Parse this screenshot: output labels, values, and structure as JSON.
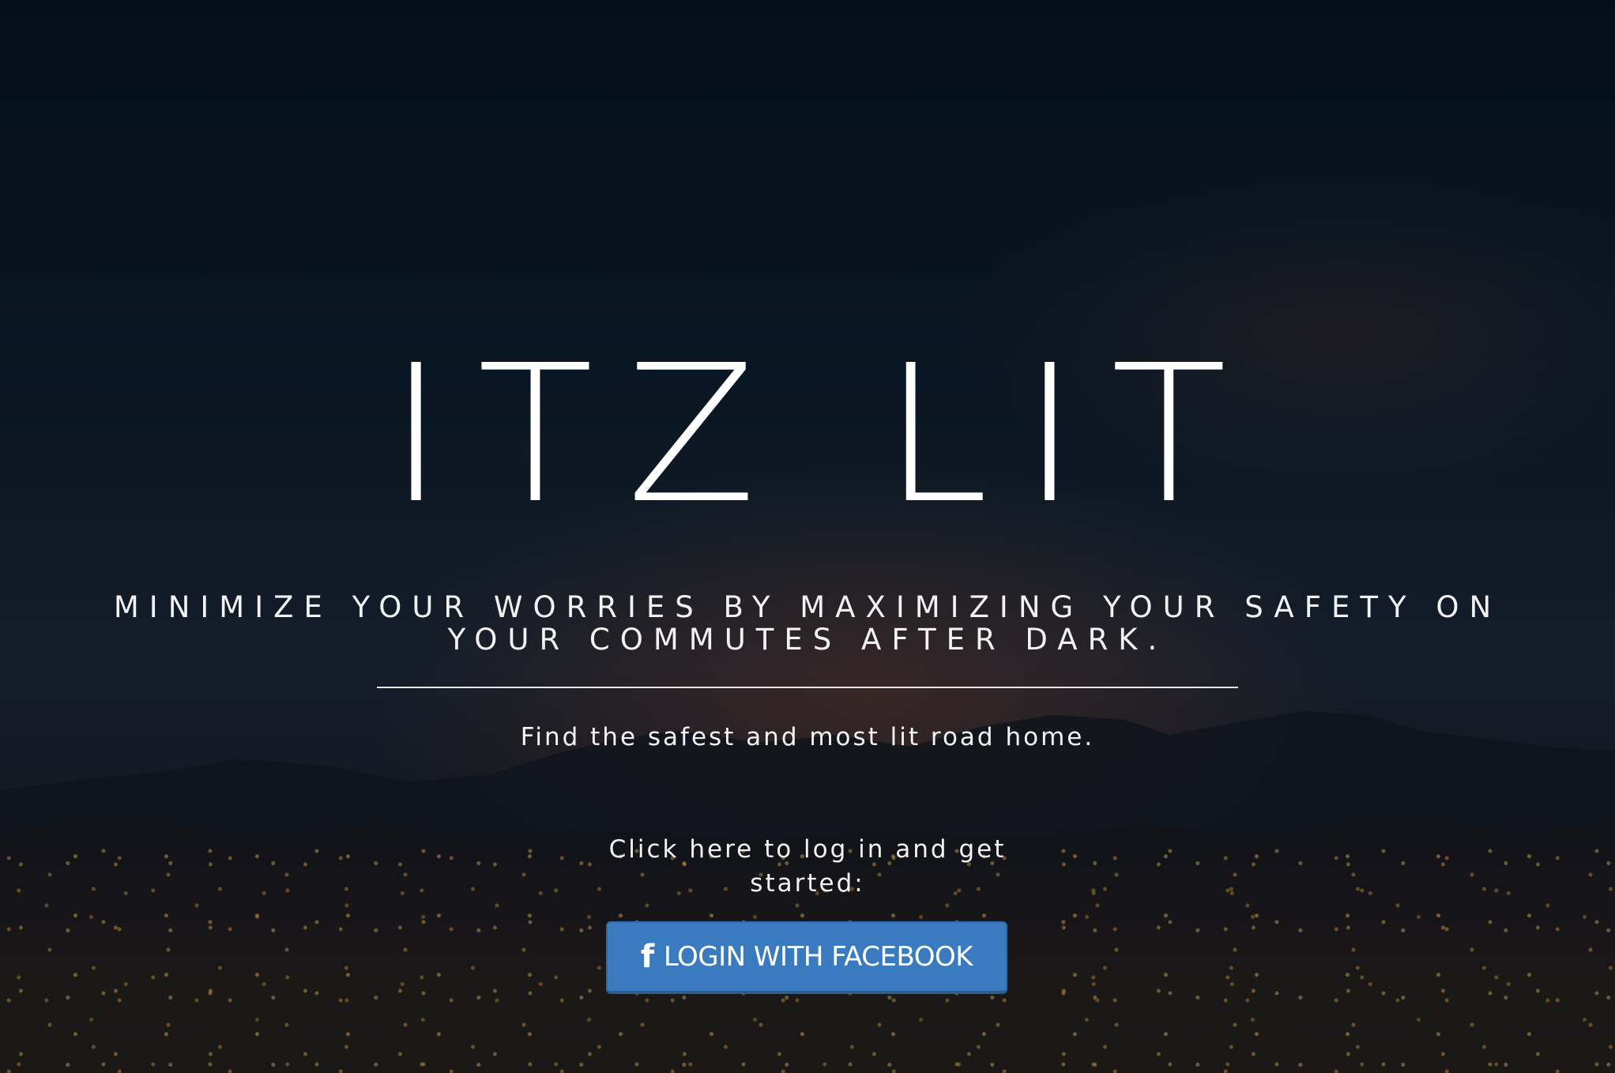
{
  "hero": {
    "title": "ITZ LIT",
    "tagline": "MINIMIZE YOUR WORRIES BY MAXIMIZING YOUR SAFETY ON YOUR COMMUTES AFTER DARK.",
    "subtitle": "Find the safest and most lit road home.",
    "cta_text": "Click here to log in and get started:",
    "login_button": {
      "icon": "facebook-icon",
      "icon_glyph": "f",
      "label": "LOGIN WITH FACEBOOK"
    }
  },
  "colors": {
    "button_bg": "#3a7bc0",
    "text": "#ffffff",
    "background": "#0a1420"
  }
}
